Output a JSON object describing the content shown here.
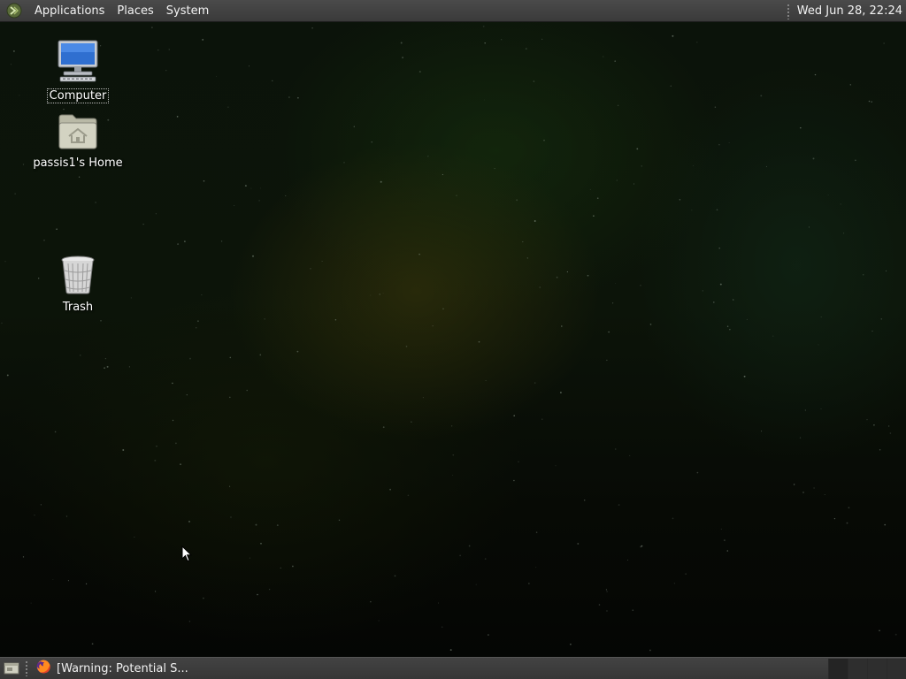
{
  "top_panel": {
    "menus": [
      "Applications",
      "Places",
      "System"
    ],
    "clock": "Wed Jun 28, 22:24"
  },
  "desktop": {
    "icons": [
      {
        "label": "Computer",
        "icon": "computer-icon"
      },
      {
        "label": "passis1's Home",
        "icon": "home-folder-icon"
      },
      {
        "label": "Trash",
        "icon": "trash-icon"
      }
    ]
  },
  "bottom_panel": {
    "show_desktop_icon": "show-desktop-icon",
    "tasks": [
      {
        "label": "[Warning: Potential S...",
        "icon": "firefox-icon"
      }
    ],
    "workspace_count": 4
  }
}
